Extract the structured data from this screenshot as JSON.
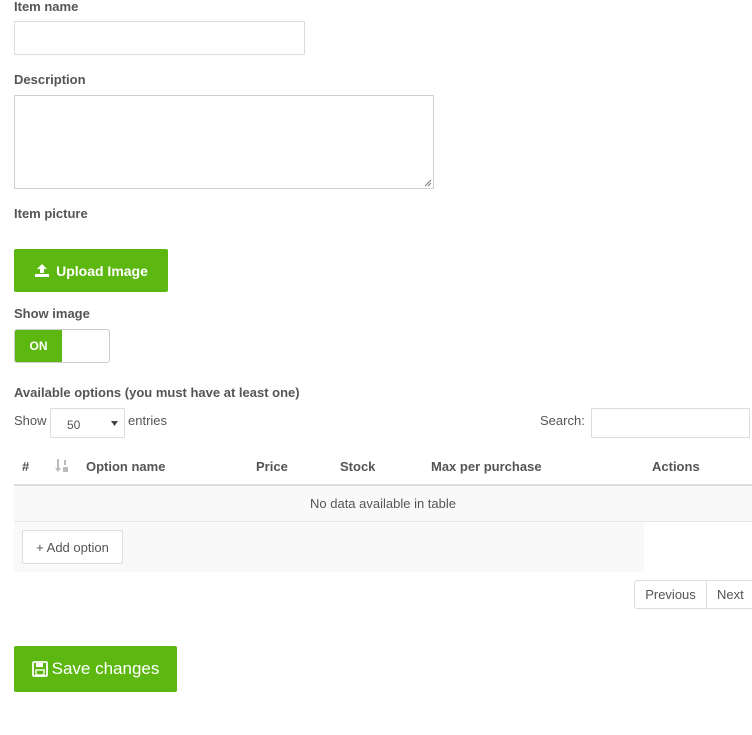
{
  "form": {
    "item_name_label": "Item name",
    "item_name_value": "",
    "description_label": "Description",
    "description_value": "",
    "item_picture_label": "Item picture",
    "upload_label": "Upload Image",
    "show_image_label": "Show image",
    "toggle_on_label": "ON",
    "toggle_state": true,
    "options_label": "Available options (you must have at least one)"
  },
  "table_controls": {
    "show_label": "Show",
    "entries_value": "50",
    "entries_label": "entries",
    "search_label": "Search:",
    "search_value": ""
  },
  "table": {
    "columns": [
      "#",
      "Option name",
      "Price",
      "Stock",
      "Max per purchase",
      "Actions"
    ],
    "empty_message": "No data available in table",
    "add_option_label": "+ Add option"
  },
  "pagination": {
    "previous_label": "Previous",
    "next_label": "Next"
  },
  "footer": {
    "save_label": "Save changes"
  },
  "colors": {
    "accent": "#5cb811",
    "text": "#555555",
    "border": "#dcdcdc"
  },
  "icons": [
    "upload-icon",
    "sort-numeric-icon",
    "save-icon",
    "select-caret-icon"
  ]
}
